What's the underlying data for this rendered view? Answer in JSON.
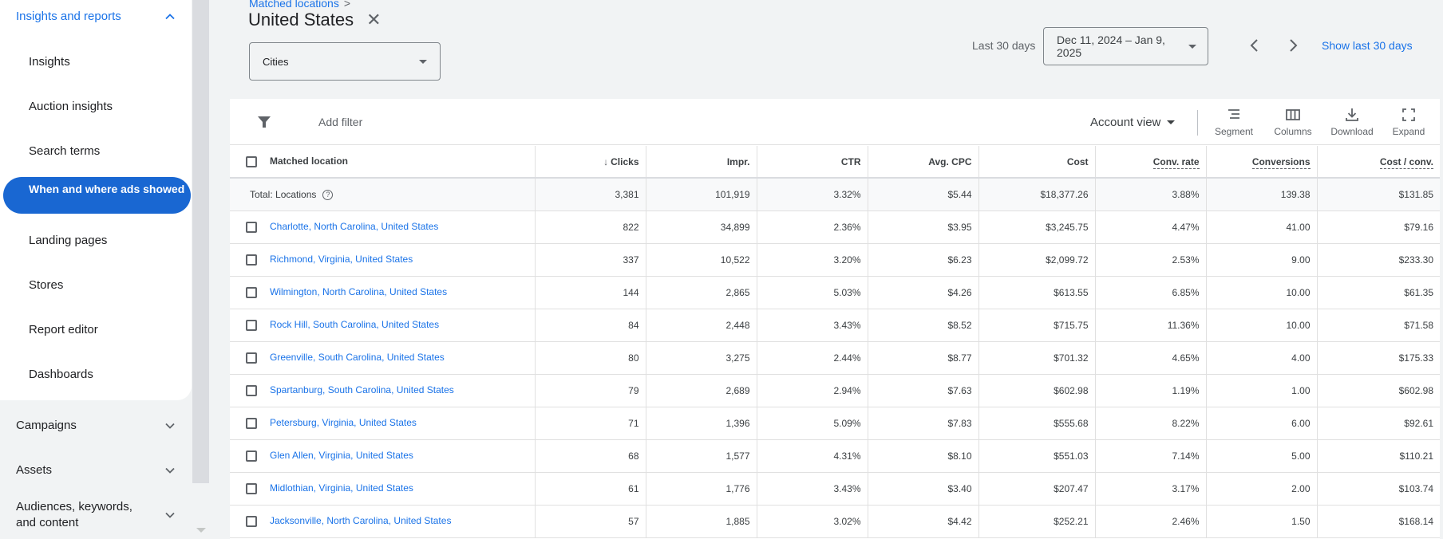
{
  "sidebar": {
    "section_active": {
      "label": "Insights and reports",
      "expanded": true
    },
    "sub_items": [
      {
        "label": "Insights"
      },
      {
        "label": "Auction insights"
      },
      {
        "label": "Search terms"
      },
      {
        "label": "When and where ads showed",
        "selected": true
      },
      {
        "label": "Landing pages"
      },
      {
        "label": "Stores"
      },
      {
        "label": "Report editor"
      },
      {
        "label": "Dashboards"
      }
    ],
    "sections": [
      {
        "label": "Campaigns"
      },
      {
        "label": "Assets"
      },
      {
        "label": "Audiences, keywords, and content"
      }
    ]
  },
  "header": {
    "breadcrumb": "Matched locations",
    "breadcrumb_sep": ">",
    "title": "United States",
    "close_glyph": "✕",
    "level_select": "Cities",
    "date_label": "Last 30 days",
    "date_range": "Dec 11, 2024 – Jan 9, 2025",
    "show_last": "Show last 30 days"
  },
  "toolbar": {
    "add_filter": "Add filter",
    "account_view": "Account view",
    "buttons": [
      {
        "label": "Segment",
        "icon": "segment-icon"
      },
      {
        "label": "Columns",
        "icon": "columns-icon"
      },
      {
        "label": "Download",
        "icon": "download-icon"
      },
      {
        "label": "Expand",
        "icon": "expand-icon"
      }
    ]
  },
  "table": {
    "columns": [
      "Matched location",
      "Clicks",
      "Impr.",
      "CTR",
      "Avg. CPC",
      "Cost",
      "Conv. rate",
      "Conversions",
      "Cost / conv."
    ],
    "sort_glyph": "↓",
    "total": {
      "label": "Total: Locations",
      "help_glyph": "?",
      "values": [
        "3,381",
        "101,919",
        "3.32%",
        "$5.44",
        "$18,377.26",
        "3.88%",
        "139.38",
        "$131.85"
      ]
    },
    "rows": [
      {
        "location": "Charlotte, North Carolina, United States",
        "values": [
          "822",
          "34,899",
          "2.36%",
          "$3.95",
          "$3,245.75",
          "4.47%",
          "41.00",
          "$79.16"
        ]
      },
      {
        "location": "Richmond, Virginia, United States",
        "values": [
          "337",
          "10,522",
          "3.20%",
          "$6.23",
          "$2,099.72",
          "2.53%",
          "9.00",
          "$233.30"
        ]
      },
      {
        "location": "Wilmington, North Carolina, United States",
        "values": [
          "144",
          "2,865",
          "5.03%",
          "$4.26",
          "$613.55",
          "6.85%",
          "10.00",
          "$61.35"
        ]
      },
      {
        "location": "Rock Hill, South Carolina, United States",
        "values": [
          "84",
          "2,448",
          "3.43%",
          "$8.52",
          "$715.75",
          "11.36%",
          "10.00",
          "$71.58"
        ]
      },
      {
        "location": "Greenville, South Carolina, United States",
        "values": [
          "80",
          "3,275",
          "2.44%",
          "$8.77",
          "$701.32",
          "4.65%",
          "4.00",
          "$175.33"
        ]
      },
      {
        "location": "Spartanburg, South Carolina, United States",
        "values": [
          "79",
          "2,689",
          "2.94%",
          "$7.63",
          "$602.98",
          "1.19%",
          "1.00",
          "$602.98"
        ]
      },
      {
        "location": "Petersburg, Virginia, United States",
        "values": [
          "71",
          "1,396",
          "5.09%",
          "$7.83",
          "$555.68",
          "8.22%",
          "6.00",
          "$92.61"
        ]
      },
      {
        "location": "Glen Allen, Virginia, United States",
        "values": [
          "68",
          "1,577",
          "4.31%",
          "$8.10",
          "$551.03",
          "7.14%",
          "5.00",
          "$110.21"
        ]
      },
      {
        "location": "Midlothian, Virginia, United States",
        "values": [
          "61",
          "1,776",
          "3.43%",
          "$3.40",
          "$207.47",
          "3.17%",
          "2.00",
          "$103.74"
        ]
      },
      {
        "location": "Jacksonville, North Carolina, United States",
        "values": [
          "57",
          "1,885",
          "3.02%",
          "$4.42",
          "$252.21",
          "2.46%",
          "1.50",
          "$168.14"
        ]
      }
    ]
  },
  "colors": {
    "accent": "#1a73e8",
    "selected_bg": "#1967d2",
    "page_bg": "#f1f3f4"
  }
}
